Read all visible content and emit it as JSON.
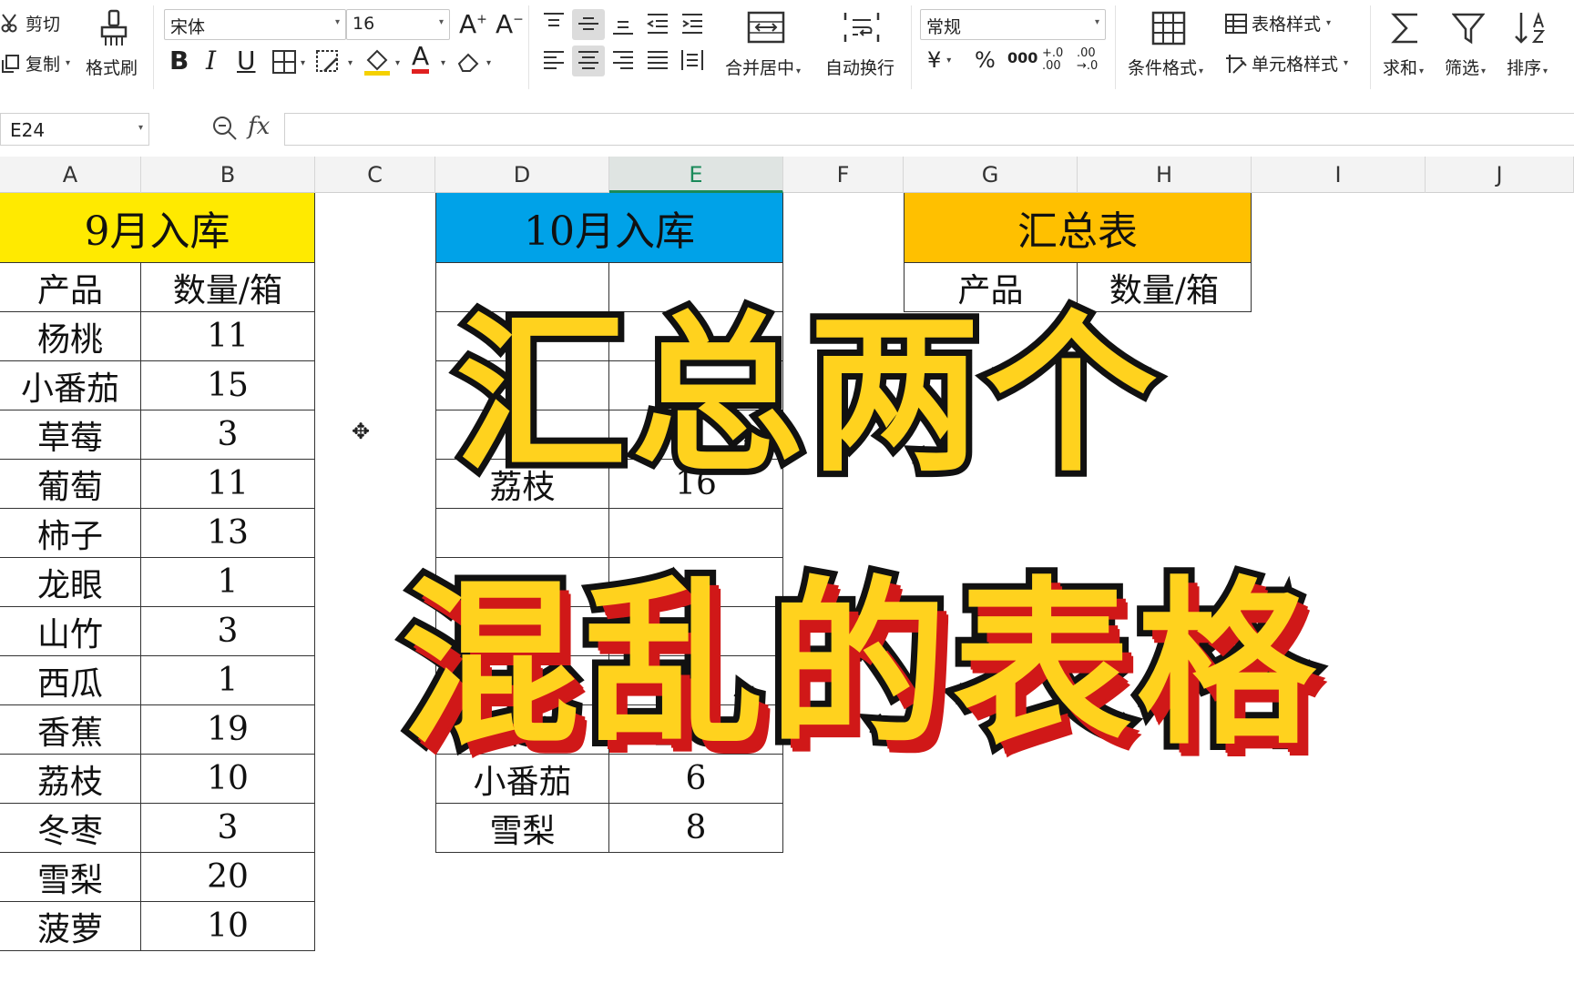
{
  "ribbon": {
    "cut": "剪切",
    "copy": "复制",
    "format_painter": "格式刷",
    "font_name": "宋体",
    "font_size": "16",
    "merge_center": "合并居中",
    "wrap_text": "自动换行",
    "number_format": "常规",
    "conditional_format": "条件格式",
    "table_style": "表格样式",
    "cell_style": "单元格样式",
    "sum": "求和",
    "filter": "筛选",
    "sort": "排序",
    "currency": "¥",
    "percent": "%",
    "thousands": "000",
    "inc_decimal": "+.0 .00",
    "dec_decimal": ".00 →.0",
    "bold": "B",
    "italic": "I",
    "underline": "U",
    "font_color_letter": "A"
  },
  "formula_bar": {
    "name_box": "E24",
    "fx": "fx",
    "formula": ""
  },
  "columns": [
    "A",
    "B",
    "C",
    "D",
    "E",
    "F",
    "G",
    "H",
    "I",
    "J"
  ],
  "selected_column": "E",
  "table_sep": {
    "title": "9月入库",
    "title_color": "#ffea00",
    "header": [
      "产品",
      "数量/箱"
    ],
    "rows": [
      [
        "杨桃",
        "11"
      ],
      [
        "小番茄",
        "15"
      ],
      [
        "草莓",
        "3"
      ],
      [
        "葡萄",
        "11"
      ],
      [
        "柿子",
        "13"
      ],
      [
        "龙眼",
        "1"
      ],
      [
        "山竹",
        "3"
      ],
      [
        "西瓜",
        "1"
      ],
      [
        "香蕉",
        "19"
      ],
      [
        "荔枝",
        "10"
      ],
      [
        "冬枣",
        "3"
      ],
      [
        "雪梨",
        "20"
      ],
      [
        "菠萝",
        "10"
      ]
    ]
  },
  "table_oct": {
    "title": "10月入库",
    "title_color": "#00a2e8",
    "visible_rows": [
      [
        "荔枝",
        "16"
      ],
      [
        "香蕉",
        "9"
      ],
      [
        "小番茄",
        "6"
      ],
      [
        "雪梨",
        "8"
      ]
    ]
  },
  "table_summary": {
    "title": "汇总表",
    "title_color": "#ffc000",
    "header_visible": [
      "产品",
      "数量/箱"
    ]
  },
  "overlay": {
    "line1": "汇总两个",
    "line2": "混乱的表格",
    "fill_color": "#ffd21e",
    "shadow_color": "#d01818"
  }
}
